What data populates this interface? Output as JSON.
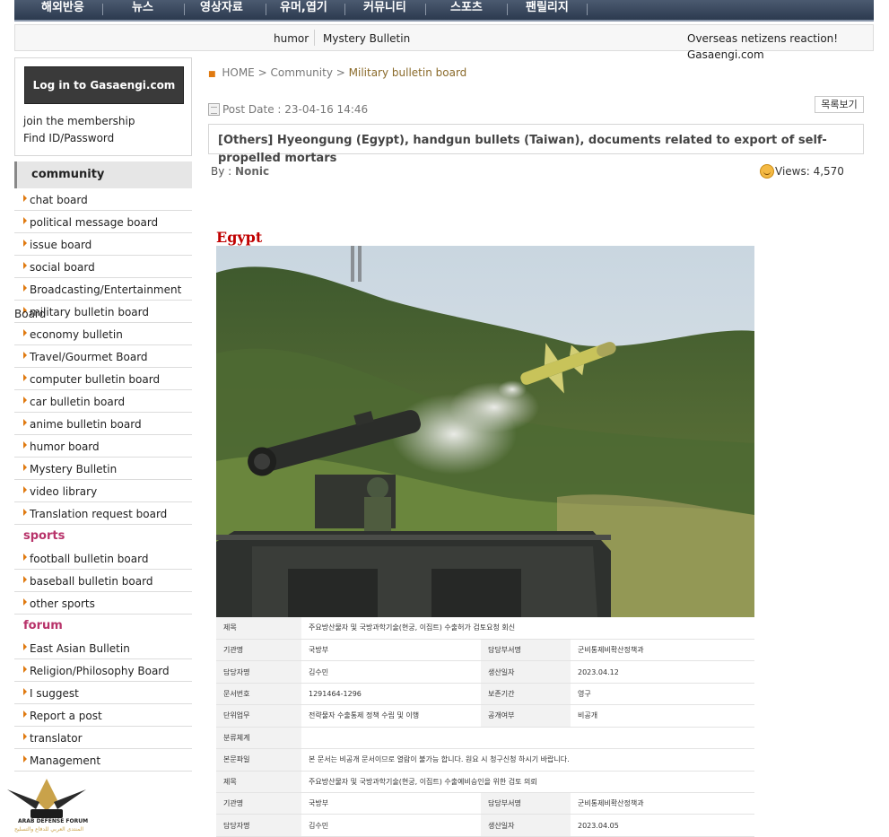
{
  "topnav": {
    "items": [
      "해외반응",
      "뉴스",
      "영상자료",
      "유머,엽기",
      "커뮤니티",
      "스포츠",
      "팬릴리지"
    ]
  },
  "subnav": {
    "humor": "humor",
    "mystery": "Mystery Bulletin",
    "overseas": "Overseas netizens reaction!",
    "site": "Gasaengi.com"
  },
  "login": {
    "button": "Log in to Gasaengi.com",
    "join": "join the membership",
    "find": "Find ID/Password"
  },
  "sidebar": {
    "community_title": "community",
    "community_items": [
      "chat board",
      "political message board",
      "issue board",
      "social board",
      "Broadcasting/Entertainment",
      "military bulletin board",
      "economy bulletin",
      "Travel/Gourmet Board",
      "computer bulletin board",
      "car bulletin board",
      "anime bulletin board",
      "humor board",
      "Mystery Bulletin",
      "video library",
      "Translation request board"
    ],
    "overlap_text": "Board",
    "sports_title": "sports",
    "sports_items": [
      "football bulletin board",
      "baseball bulletin board",
      "other sports"
    ],
    "forum_title": "forum",
    "forum_items": [
      "East Asian Bulletin",
      "Religion/Philosophy Board",
      "I suggest",
      "Report a post",
      "translator",
      "Management"
    ]
  },
  "breadcrumb": {
    "bullet": "■",
    "home": "HOME",
    "sep": ">",
    "community": "Community",
    "current": "Military bulletin board"
  },
  "post": {
    "date": "Post Date : 23-04-16 14:46",
    "list_button": "목록보기",
    "title": "[Others] Hyeongung (Egypt), handgun bullets (Taiwan), documents related to export of self-propelled mortars",
    "by_label": "By :",
    "author": "Nonic",
    "views": "Views: 4,570",
    "section_heading": "Egypt"
  },
  "doc_table": {
    "rows": [
      [
        "제목",
        "주요방산물자 및 국방과학기술(현궁, 이집트) 수출허가 검토요청 회신",
        "",
        ""
      ],
      [
        "기관명",
        "국방부",
        "담당부서명",
        "군비통제비확산정책과"
      ],
      [
        "담당자명",
        "김수민",
        "생산일자",
        "2023.04.12"
      ],
      [
        "문서번호",
        "1291464-1296",
        "보존기간",
        "영구"
      ],
      [
        "단위업무",
        "전략물자 수출통제 정책 수립 및 이행",
        "공개여부",
        "비공개"
      ],
      [
        "분류체계",
        "",
        "",
        ""
      ],
      [
        "본문파일",
        "본 문서는 비공개 문서이므로 열람이 불가능 합니다. 원요 시 청구신청 하시기 바랍니다.",
        "",
        ""
      ],
      [
        "제목",
        "주요방산물자 및 국방과학기술(현궁, 이집트) 수출예비승인을 위한 검토 의뢰",
        "",
        ""
      ],
      [
        "기관명",
        "국방부",
        "담당부서명",
        "군비통제비확산정책과"
      ],
      [
        "담당자명",
        "김수민",
        "생산일자",
        "2023.04.05"
      ]
    ]
  },
  "logo": {
    "text": "ARAB DEFENSE FORUM",
    "subtext": "المنتدى العربي للدفاع والتسليح"
  },
  "colors": {
    "nav_bg": "#2c3a4f",
    "accent_orange": "#e07a10",
    "heading_red": "#c00000",
    "section_pink": "#b8336a"
  }
}
